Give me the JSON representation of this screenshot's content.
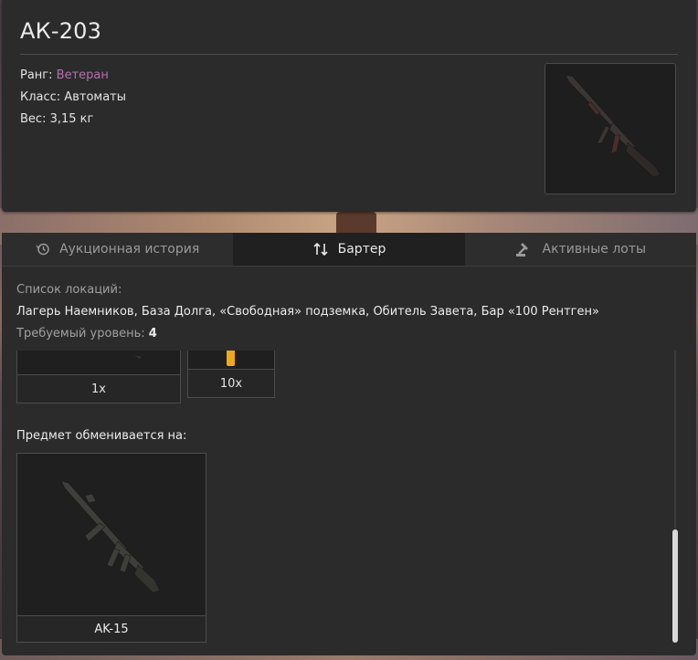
{
  "item": {
    "title": "АК-203",
    "rank_label": "Ранг:",
    "rank_value": "Ветеран",
    "class_line": "Класс: Автоматы",
    "weight_line": "Вес: 3,15 кг"
  },
  "tabs": [
    {
      "label": "Аукционная история",
      "icon": "history-icon"
    },
    {
      "label": "Бартер",
      "icon": "swap-icon"
    },
    {
      "label": "Активные лоты",
      "icon": "gavel-icon"
    }
  ],
  "barter": {
    "locations_label": "Список локаций:",
    "locations": "Лагерь Наемников, База Долга, «Свободная» подземка, Обитель Завета, Бар «100 Рентген»",
    "level_label": "Требуемый уровень:",
    "level_value": "4",
    "required_items": [
      {
        "quantity": "1x"
      },
      {
        "quantity": "10x"
      }
    ],
    "exchange_label": "Предмет обменивается на:",
    "result_item": {
      "name": "AK-15"
    }
  },
  "colors": {
    "rank": "#b86fb0",
    "panel": "#2b2b2b",
    "active_tab": "#202020"
  }
}
